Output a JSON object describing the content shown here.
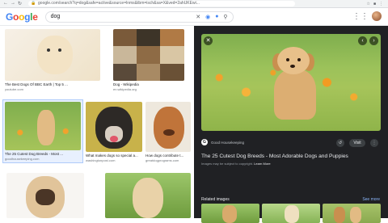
{
  "browser": {
    "url": "google.com/search?q=dog&safe=active&source=lnms&tbm=isch&sa=X&ved=2ahUKEwi...",
    "nav_icons": [
      "back-icon",
      "forward-icon",
      "reload-icon"
    ]
  },
  "google": {
    "logo": "Google",
    "query": "dog"
  },
  "results": [
    {
      "caption": "The Best Dogs Of BBC Earth | Top 5 ...",
      "source": "youtube.com"
    },
    {
      "caption": "Dog - Wikipedia",
      "source": "en.wikipedia.org"
    },
    {
      "caption": "The 25 Cutest Dog Breeds - Most ...",
      "source": "goodhousekeeping.com"
    },
    {
      "caption": "What makes dogs so special a...",
      "source": "washingtonpost.com"
    },
    {
      "caption": "How dogs contribute t...",
      "source": "greatdogprograms.com"
    }
  ],
  "panel": {
    "source_name": "Good Housekeeping",
    "title": "The 25 Cutest Dog Breeds - Most Adorable Dogs and Puppies",
    "subtitle": "Images may be subject to copyright.",
    "learn_more": "Learn More",
    "visit": "Visit",
    "related_label": "Related images",
    "see_more": "See more"
  }
}
